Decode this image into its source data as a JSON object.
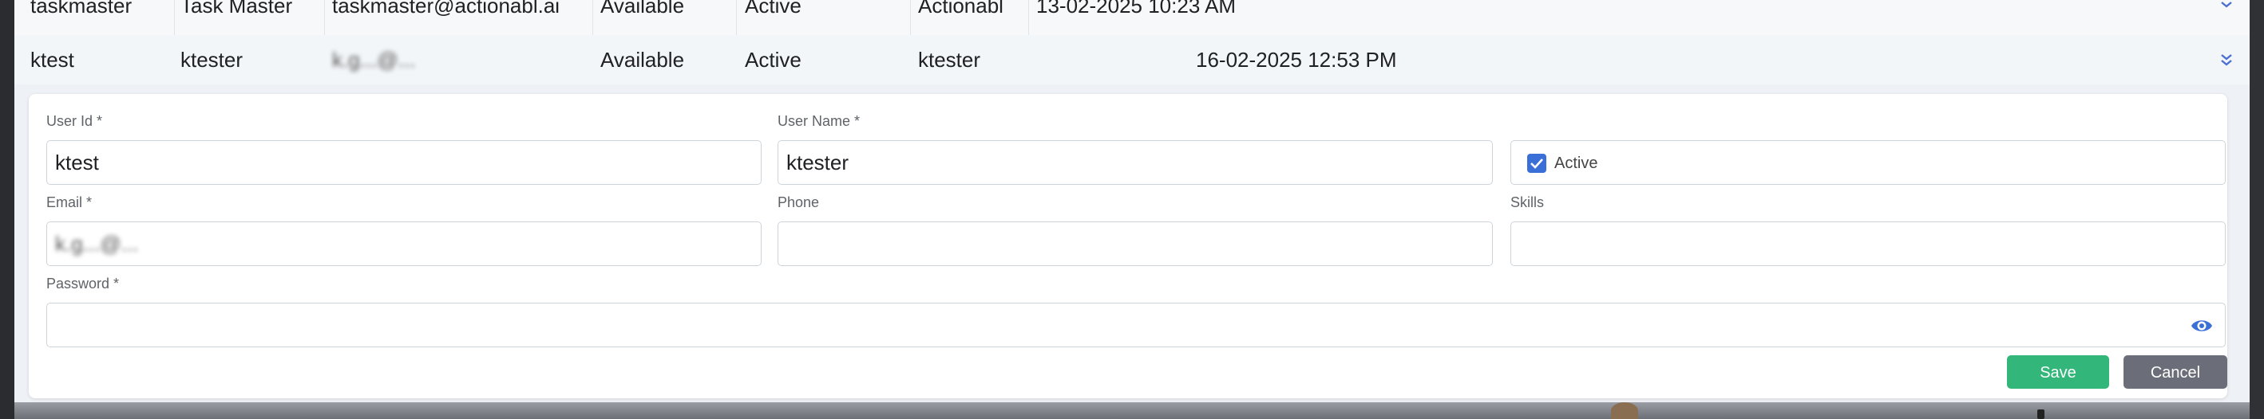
{
  "table": {
    "rows": [
      {
        "user_id": "taskmaster",
        "user_name": "Task Master",
        "email": "taskmaster@actionabl.ai",
        "availability": "Available",
        "status": "Active",
        "created_by": "Actionabl",
        "created_at": "13-02-2025 10:23 AM"
      },
      {
        "user_id": "ktest",
        "user_name": "ktester",
        "email": "k.g...@...",
        "availability": "Available",
        "status": "Active",
        "created_by": "ktester",
        "created_at": "16-02-2025 12:53 PM"
      }
    ]
  },
  "form": {
    "user_id": {
      "label": "User Id *",
      "value": "ktest"
    },
    "user_name": {
      "label": "User Name *",
      "value": "ktester"
    },
    "active": {
      "label": "Active",
      "checked": true
    },
    "email": {
      "label": "Email *",
      "value": "k.g...@..."
    },
    "phone": {
      "label": "Phone",
      "value": ""
    },
    "skills": {
      "label": "Skills",
      "value": ""
    },
    "password": {
      "label": "Password *",
      "value": ""
    },
    "save_label": "Save",
    "cancel_label": "Cancel"
  },
  "colors": {
    "accent": "#3b6fd8",
    "save": "#33b67a",
    "cancel": "#6b6e78"
  },
  "icons": {
    "expand": "chevron-double-down-icon",
    "checkbox": "check-icon",
    "password_toggle": "eye-icon"
  }
}
